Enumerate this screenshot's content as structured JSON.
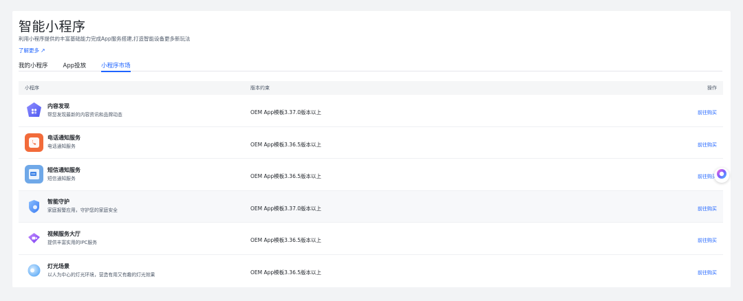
{
  "header": {
    "title": "智能小程序",
    "subtitle": "利用小程序提供的丰富基础能力完成App服务搭建,打造智能设备更多新玩法",
    "learn_more": "了解更多",
    "learn_more_icon": "external-link-icon"
  },
  "tabs": [
    {
      "label": "我的小程序",
      "active": false
    },
    {
      "label": "App投放",
      "active": false
    },
    {
      "label": "小程序市场",
      "active": true
    }
  ],
  "table": {
    "columns": [
      "小程序",
      "版本约束",
      "操作"
    ],
    "rows": [
      {
        "name": "内容发现",
        "desc": "帮您发现最新的内容资讯和品牌动态",
        "version": "OEM App模板3.37.0版本以上",
        "action": "前往购买",
        "icon": "content-discovery-icon"
      },
      {
        "name": "电话通知服务",
        "desc": "电话通知服务",
        "version": "OEM App模板3.36.5版本以上",
        "action": "前往购买",
        "icon": "phone-notification-icon"
      },
      {
        "name": "短信通知服务",
        "desc": "短信通知服务",
        "version": "OEM App模板3.36.5版本以上",
        "action": "前往购买",
        "icon": "sms-notification-icon"
      },
      {
        "name": "智能守护",
        "desc": "家庭报警应用，守护您的家庭安全",
        "version": "OEM App模板3.37.0版本以上",
        "action": "前往购买",
        "icon": "shield-icon"
      },
      {
        "name": "视频服务大厅",
        "desc": "提供丰富实用的IPC服务",
        "version": "OEM App模板3.36.5版本以上",
        "action": "前往购买",
        "icon": "video-service-icon"
      },
      {
        "name": "灯光场景",
        "desc": "以人为中心的灯光环境，营造有用又有趣的灯光效果",
        "version": "OEM App模板3.36.5版本以上",
        "action": "前往购买",
        "icon": "light-scene-icon"
      }
    ]
  },
  "floating_button": {
    "icon": "assistant-icon"
  },
  "colors": {
    "accent": "#1f64ff",
    "background": "#f2f3f5"
  }
}
